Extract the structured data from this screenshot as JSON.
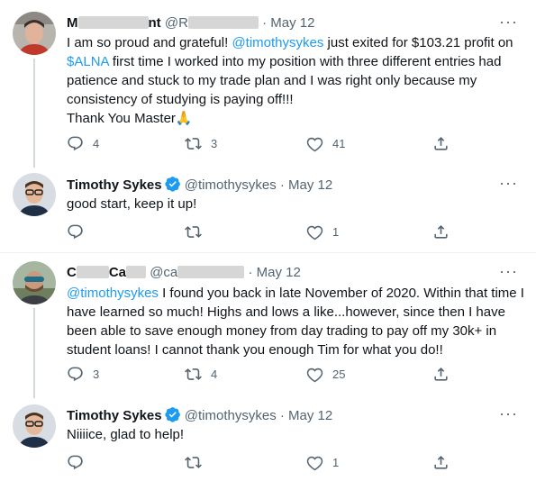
{
  "tweets": [
    {
      "name_start": "M",
      "name_end": "nt",
      "handle_start": "@R",
      "date": "May 12",
      "body_mention": "@timothysykes",
      "body_part1": " just exited for $103.21 profit on ",
      "cashtag": "$ALNA",
      "body_part2": " first time I worked into my position with three different entries had patience and stuck to my trade plan and I was right only because my consistency of studying is paying off!!!",
      "body_line_last": "Thank You Master🙏",
      "body_prefix": "I am so proud and grateful! ",
      "replies": "4",
      "retweets": "3",
      "likes": "41"
    },
    {
      "name": "Timothy Sykes",
      "handle": "@timothysykes",
      "date": "May 12",
      "body": "good start, keep it up!",
      "replies": "",
      "retweets": "",
      "likes": "1"
    },
    {
      "name_start": "C",
      "name_mid": "Ca",
      "handle_start": "@ca",
      "date": "May 12",
      "body_mention": "@timothysykes",
      "body_rest": " I found you back in late November of 2020. Within that time I have learned so much! Highs and lows a like...however, since then I have been able to save enough money from day trading to pay off my 30k+ in student loans! I cannot thank you enough Tim for what you do!!",
      "replies": "3",
      "retweets": "4",
      "likes": "25"
    },
    {
      "name": "Timothy Sykes",
      "handle": "@timothysykes",
      "date": "May 12",
      "body": "Niiiice, glad to help!",
      "replies": "",
      "retweets": "",
      "likes": "1"
    }
  ],
  "separator": "·",
  "more_glyph": "···",
  "colors": {
    "link": "#1d9bf0",
    "muted": "#536471",
    "verified": "#1d9bf0"
  }
}
